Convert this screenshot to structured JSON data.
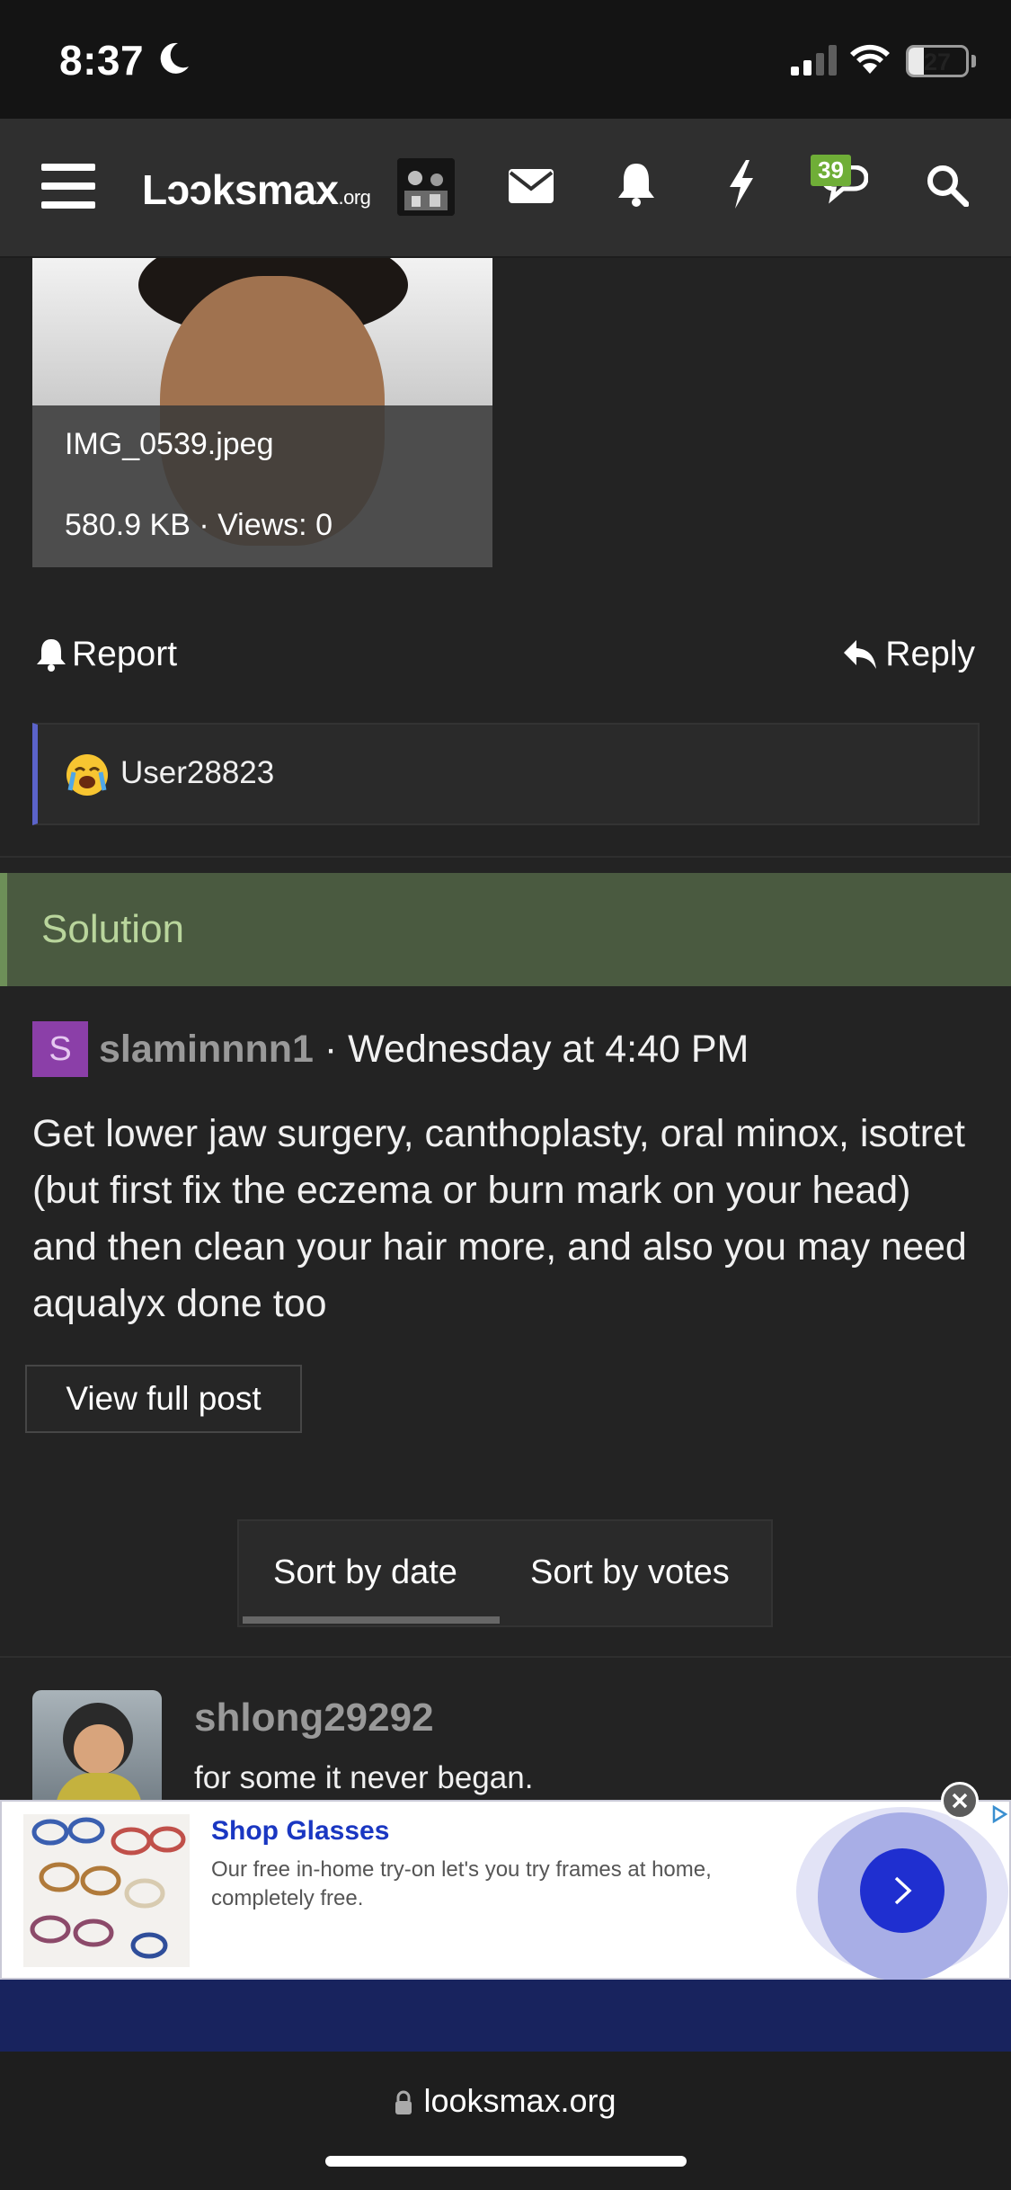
{
  "status_bar": {
    "time": "8:37",
    "battery": "27",
    "battery_level": 0.27
  },
  "nav": {
    "logo_main": "Lɔɔksmax",
    "logo_suffix": ".org",
    "chat_badge": "39"
  },
  "attachment": {
    "filename": "IMG_0539.jpeg",
    "meta": "580.9 KB · Views: 0"
  },
  "actions": {
    "report": "Report",
    "reply": "Reply"
  },
  "quote": {
    "user": "User28823"
  },
  "solution": {
    "header": "Solution",
    "avatar_letter": "S",
    "username": "slaminnnn1",
    "date": " · Wednesday at 4:40 PM",
    "body": "Get lower jaw surgery, canthoplasty, oral minox, isotret (but first fix the eczema or burn mark on your head) and then clean your hair more, and also you may need aqualyx done too",
    "view_full": "View full post"
  },
  "sort": {
    "by_date": "Sort by date",
    "by_votes": "Sort by votes"
  },
  "reply_post": {
    "username": "shlong29292",
    "text": "for some it never began."
  },
  "ad": {
    "title": "Shop Glasses",
    "description": "Our free in-home try-on let's you try frames at home, completely free."
  },
  "browser": {
    "url": "looksmax.org"
  },
  "icons": [
    "moon-icon",
    "signal-icon",
    "wifi-icon",
    "battery-icon",
    "menu-icon",
    "mail-icon",
    "bell-icon",
    "bolt-icon",
    "chat-icon",
    "search-icon",
    "report-bell-icon",
    "reply-arrow-icon",
    "crying-emoji-icon",
    "chevron-right-icon",
    "close-icon",
    "adchoices-icon",
    "lock-icon"
  ]
}
